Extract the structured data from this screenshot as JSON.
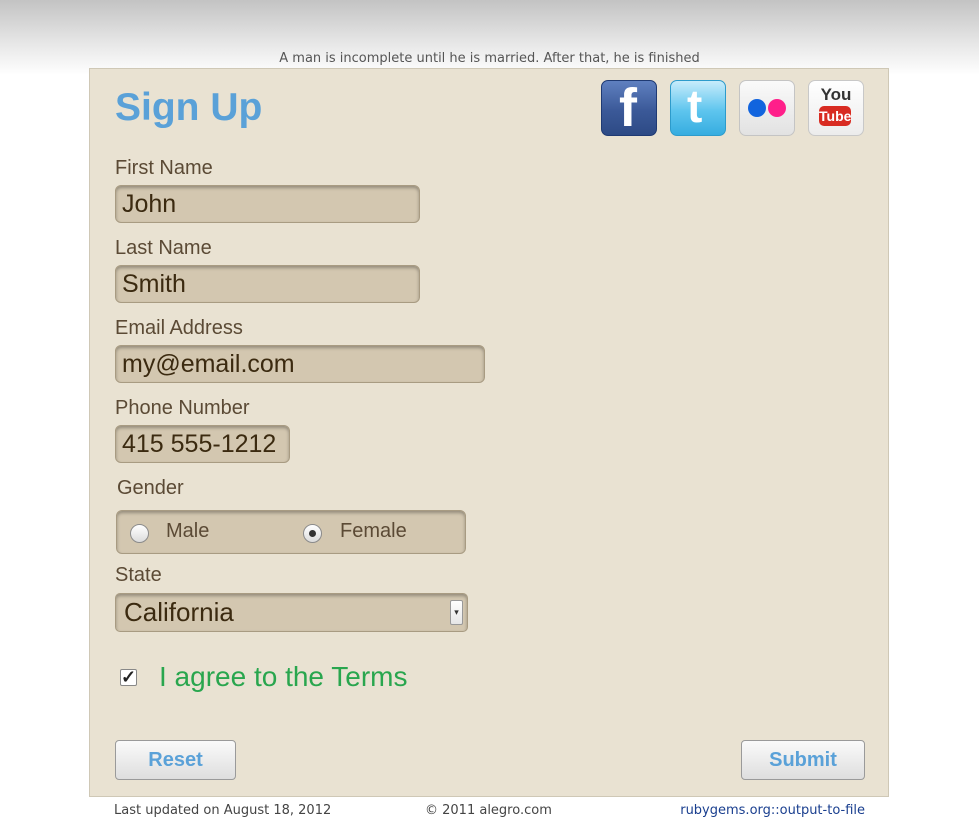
{
  "quote": "A man is incomplete until he is married. After that, he is finished",
  "form": {
    "title": "Sign Up",
    "first_name": {
      "label": "First Name",
      "value": "John"
    },
    "last_name": {
      "label": "Last Name",
      "value": "Smith"
    },
    "email": {
      "label": "Email Address",
      "value": "my@email.com"
    },
    "phone": {
      "label": "Phone Number",
      "value": "415 555-1212"
    },
    "gender": {
      "label": "Gender",
      "options": [
        "Male",
        "Female"
      ],
      "selected": "Female"
    },
    "state": {
      "label": "State",
      "value": "California"
    },
    "terms": {
      "label": "I agree to the Terms",
      "checked": true
    },
    "reset_label": "Reset",
    "submit_label": "Submit"
  },
  "social": {
    "facebook": {
      "icon": "facebook-icon",
      "glyph": "f"
    },
    "twitter": {
      "icon": "twitter-icon",
      "glyph": "t"
    },
    "flickr": {
      "icon": "flickr-icon"
    },
    "youtube": {
      "icon": "youtube-icon",
      "text_top": "You",
      "text_bottom": "Tube"
    }
  },
  "footer": {
    "updated": "Last updated on August 18, 2012",
    "copyright": "© 2011 alegro.com",
    "link": "rubygems.org::output-to-file"
  },
  "colors": {
    "title": "#5aa1d8",
    "terms": "#29a64e",
    "panel": "#e9e2d2",
    "field": "#d3c7b0",
    "link": "#1a3f8f"
  }
}
